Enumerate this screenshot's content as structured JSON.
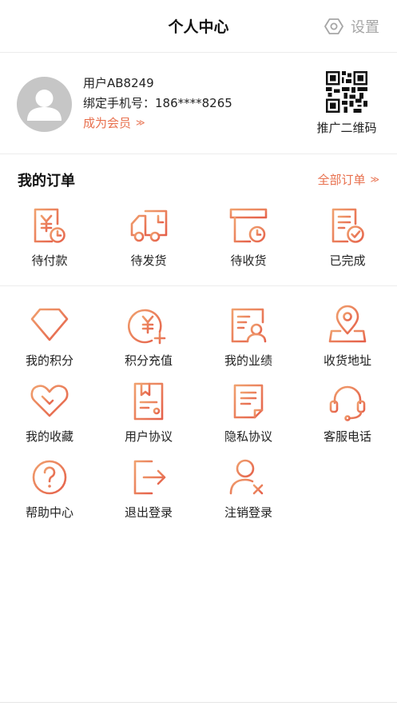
{
  "header": {
    "title": "个人中心",
    "settings_label": "设置"
  },
  "profile": {
    "username": "用户AB8249",
    "phone_line": "绑定手机号：186****8265",
    "member_link": "成为会员",
    "qr_label": "推广二维码"
  },
  "orders": {
    "title": "我的订单",
    "all_label": "全部订单",
    "items": [
      {
        "label": "待付款",
        "icon": "pending-payment-icon"
      },
      {
        "label": "待发货",
        "icon": "truck-icon"
      },
      {
        "label": "待收货",
        "icon": "package-clock-icon"
      },
      {
        "label": "已完成",
        "icon": "completed-check-icon"
      }
    ]
  },
  "services": {
    "items": [
      {
        "label": "我的积分",
        "icon": "diamond-icon"
      },
      {
        "label": "积分充值",
        "icon": "coin-plus-icon"
      },
      {
        "label": "我的业绩",
        "icon": "performance-card-icon"
      },
      {
        "label": "收货地址",
        "icon": "location-pin-icon"
      },
      {
        "label": "我的收藏",
        "icon": "heart-icon"
      },
      {
        "label": "用户协议",
        "icon": "agreement-book-icon"
      },
      {
        "label": "隐私协议",
        "icon": "document-icon"
      },
      {
        "label": "客服电话",
        "icon": "headset-icon"
      },
      {
        "label": "帮助中心",
        "icon": "help-question-icon"
      },
      {
        "label": "退出登录",
        "icon": "logout-icon"
      },
      {
        "label": "注销登录",
        "icon": "user-remove-icon"
      }
    ]
  },
  "colors": {
    "accent": "#e8704e",
    "accent_light": "#f0a06e",
    "avatar_bg": "#c6c6c6",
    "muted": "#a6a6a6"
  }
}
